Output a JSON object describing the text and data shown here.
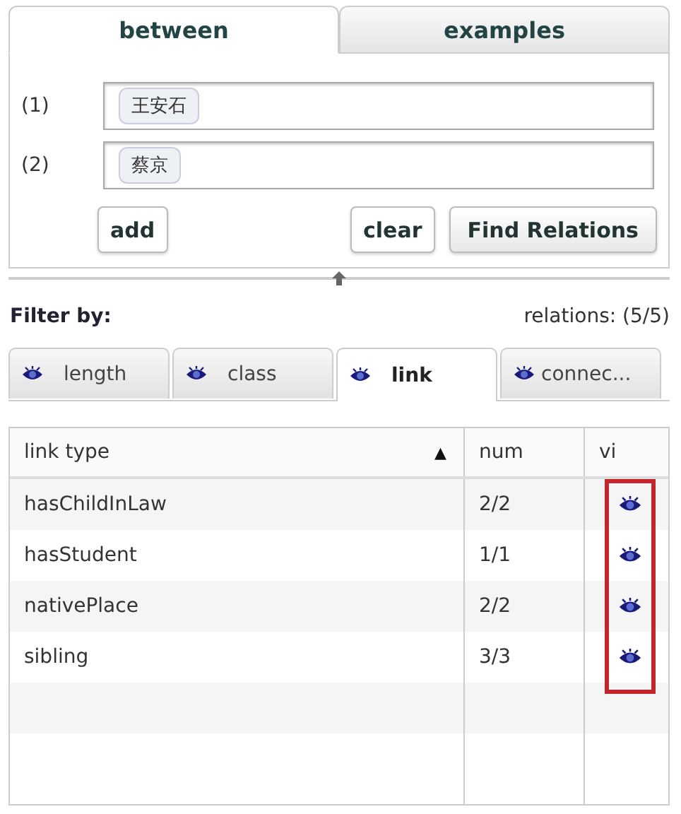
{
  "main_tabs": [
    {
      "label": "between",
      "selected": true
    },
    {
      "label": "examples",
      "selected": false
    }
  ],
  "inputs": [
    {
      "label": "(1)",
      "chips": [
        "王安石"
      ]
    },
    {
      "label": "(2)",
      "chips": [
        "蔡京"
      ]
    }
  ],
  "buttons": [
    {
      "label": "add",
      "kind": "plain"
    },
    {
      "label": "clear",
      "kind": "plain"
    },
    {
      "label": "Find Relations",
      "kind": "primary"
    }
  ],
  "filter": {
    "label": "Filter by:",
    "relations": "relations: (5/5)"
  },
  "filter_tabs": [
    {
      "label": "length",
      "selected": false
    },
    {
      "label": "class",
      "selected": false
    },
    {
      "label": "link",
      "selected": true
    },
    {
      "label": "connec...",
      "selected": false
    }
  ],
  "table": {
    "columns": [
      {
        "label": "link type",
        "sort_mark": "▲"
      },
      {
        "label": "num"
      },
      {
        "label": "vi"
      }
    ],
    "rows": [
      {
        "type": "hasChildInLaw",
        "num": "2/2",
        "visible": true
      },
      {
        "type": "hasStudent",
        "num": "1/1",
        "visible": true
      },
      {
        "type": "nativePlace",
        "num": "2/2",
        "visible": true
      },
      {
        "type": "sibling",
        "num": "3/3",
        "visible": true
      }
    ],
    "highlight_visibility": true
  }
}
